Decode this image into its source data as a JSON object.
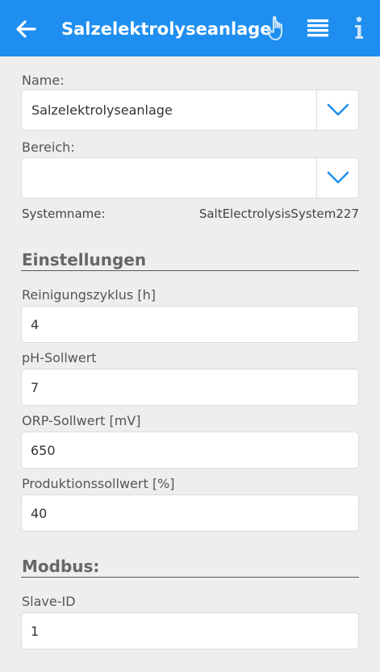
{
  "header": {
    "title": "Salzelektrolyseanlage",
    "icons": [
      "back-arrow-icon",
      "hand-pointer-icon",
      "list-icon",
      "info-icon"
    ]
  },
  "colors": {
    "header_bg": "#1e8ff0",
    "accent": "#1e8ff0"
  },
  "fields": {
    "name_label": "Name:",
    "name_value": "Salzelektrolyseanlage",
    "area_label": "Bereich:",
    "area_value": "",
    "systemname_label": "Systemname:",
    "systemname_value": "SaltElectrolysisSystem227"
  },
  "settings": {
    "title": "Einstellungen",
    "cleaning_label": "Reinigungszyklus [h]",
    "cleaning_value": "4",
    "ph_label": "pH-Sollwert",
    "ph_value": "7",
    "orp_label": "ORP-Sollwert [mV]",
    "orp_value": "650",
    "production_label": "Produktionssollwert [%]",
    "production_value": "40"
  },
  "modbus": {
    "title": "Modbus:",
    "slave_label": "Slave-ID",
    "slave_value": "1"
  }
}
